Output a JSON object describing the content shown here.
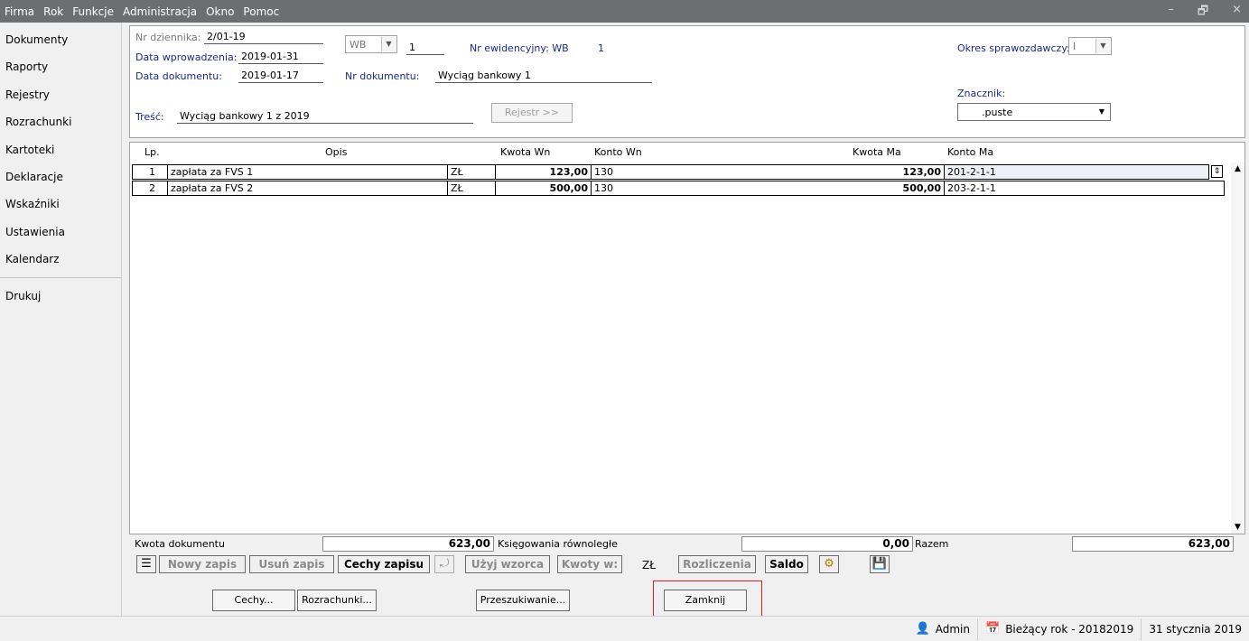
{
  "menu": [
    "Firma",
    "Rok",
    "Funkcje",
    "Administracja",
    "Okno",
    "Pomoc"
  ],
  "window_controls": {
    "minimize": "–",
    "restore": "🗗",
    "close": "×"
  },
  "sidebar": {
    "items": [
      "Dokumenty",
      "Raporty",
      "Rejestry",
      "Rozrachunki",
      "Kartoteki",
      "Deklaracje",
      "Wskaźniki",
      "Ustawienia",
      "Kalendarz"
    ],
    "extra": "Drukuj"
  },
  "form": {
    "nr_dziennika_label": "Nr dziennika:",
    "nr_dziennika": "2/01-19",
    "data_wprowadzenia_label": "Data wprowadzenia:",
    "data_wprowadzenia": "2019-01-31",
    "data_dokumentu_label": "Data dokumentu:",
    "data_dokumentu": "2019-01-17",
    "typ": "WB",
    "typ_nr": "1",
    "nr_ewidencyjny_label": "Nr ewidencyjny: WB",
    "nr_ewidencyjny": "1",
    "nr_dokumentu_label": "Nr dokumentu:",
    "nr_dokumentu": "Wyciąg bankowy 1",
    "tresc_label": "Treść:",
    "tresc": "Wyciąg bankowy 1 z 2019",
    "rejestr_button": "Rejestr >>",
    "okres_label": "Okres sprawozdawczy:",
    "okres": "I",
    "znacznik_label": "Znacznik:",
    "znacznik": ".puste"
  },
  "grid": {
    "headers": {
      "lp": "Lp.",
      "opis": "Opis",
      "kwota_wn": "Kwota Wn",
      "konto_wn": "Konto Wn",
      "kwota_ma": "Kwota Ma",
      "konto_ma": "Konto Ma"
    },
    "rows": [
      {
        "lp": "1",
        "opis": "zapłata za FVS 1",
        "waluta": "ZŁ",
        "kwota_wn": "123,00",
        "konto_wn": "130",
        "kwota_ma": "123,00",
        "konto_ma": "201-2-1-1"
      },
      {
        "lp": "2",
        "opis": "zapłata za FVS 2",
        "waluta": "ZŁ",
        "kwota_wn": "500,00",
        "konto_wn": "130",
        "kwota_ma": "500,00",
        "konto_ma": "203-2-1-1"
      }
    ]
  },
  "summary": {
    "kwota_dokumentu_label": "Kwota dokumentu",
    "kwota_dokumentu": "623,00",
    "ksiegowania_label": "Księgowania równoległe",
    "ksiegowania": "0,00",
    "razem_label": "Razem",
    "razem": "623,00"
  },
  "toolbar": {
    "nowy_zapis": "Nowy zapis",
    "usun_zapis": "Usuń zapis",
    "cechy_zapisu": "Cechy zapisu",
    "uzyj_wzorca": "Użyj wzorca",
    "kwoty_w": "Kwoty w:",
    "waluta": "ZŁ",
    "rozliczenia": "Rozliczenia",
    "saldo": "Saldo"
  },
  "bottom": {
    "cechy": "Cechy...",
    "rozrachunki": "Rozrachunki...",
    "przeszukiwanie": "Przeszukiwanie...",
    "zamknij": "Zamknij"
  },
  "status": {
    "user": "Admin",
    "year": "Bieżący rok - 20182019",
    "date": "31 stycznia 2019"
  }
}
